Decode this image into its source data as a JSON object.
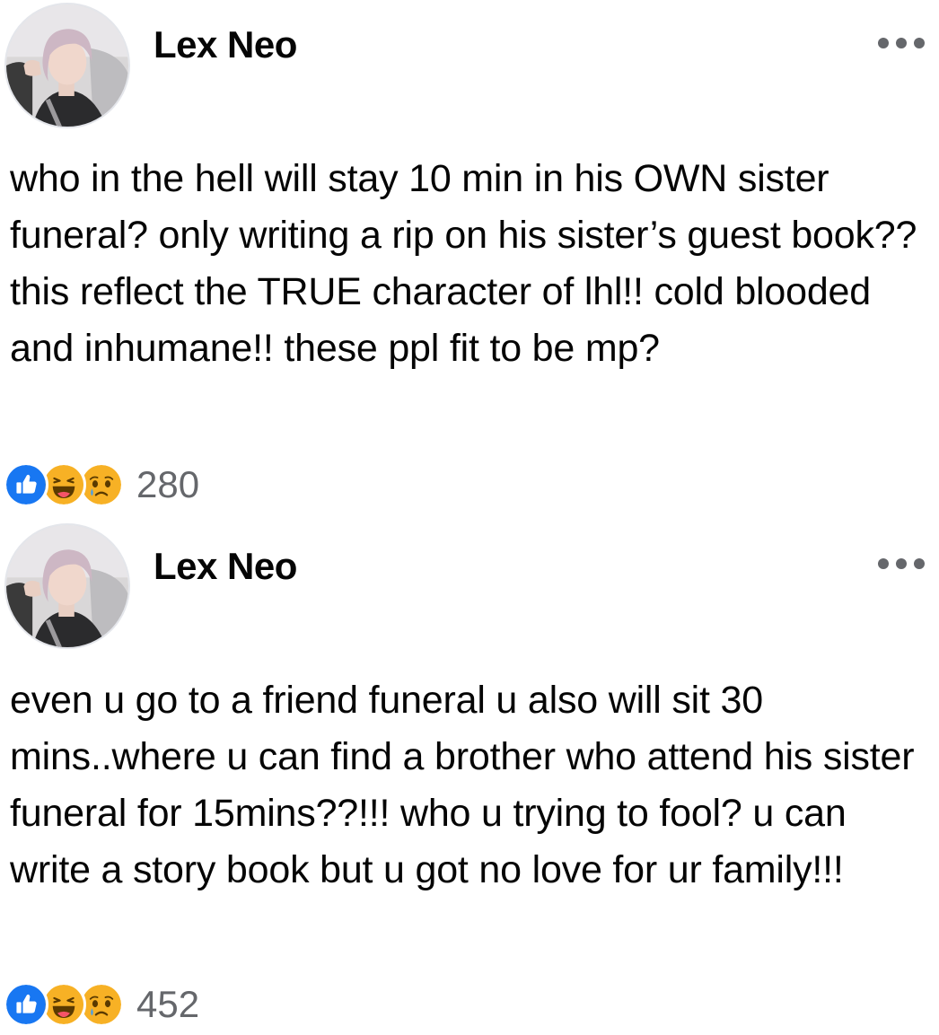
{
  "posts": [
    {
      "author": "Lex Neo",
      "avatar_icon": "profile-photo",
      "menu_icon": "more-options-icon",
      "text": "who in the hell will stay 10 min in his OWN sister funeral? only writing a rip on his sister’s guest book?? this reflect the TRUE character of lhl!! cold blooded and inhumane!! these ppl fit to be mp?",
      "reactions": {
        "icons": [
          "like-icon",
          "haha-icon",
          "sad-icon"
        ],
        "count": "280"
      }
    },
    {
      "author": "Lex Neo",
      "avatar_icon": "profile-photo",
      "menu_icon": "more-options-icon",
      "text": "even u go to a friend funeral u also will sit 30 mins..where u can find a brother who attend his sister funeral for 15mins??!!! who u trying to fool? u can write a story book but u got no love for ur family!!!",
      "reactions": {
        "icons": [
          "like-icon",
          "haha-icon",
          "sad-icon"
        ],
        "count": "452"
      }
    }
  ],
  "colors": {
    "text": "#050505",
    "secondary": "#65676b",
    "like_blue": "#1877f2",
    "emoji_yellow": "#f7b125"
  }
}
